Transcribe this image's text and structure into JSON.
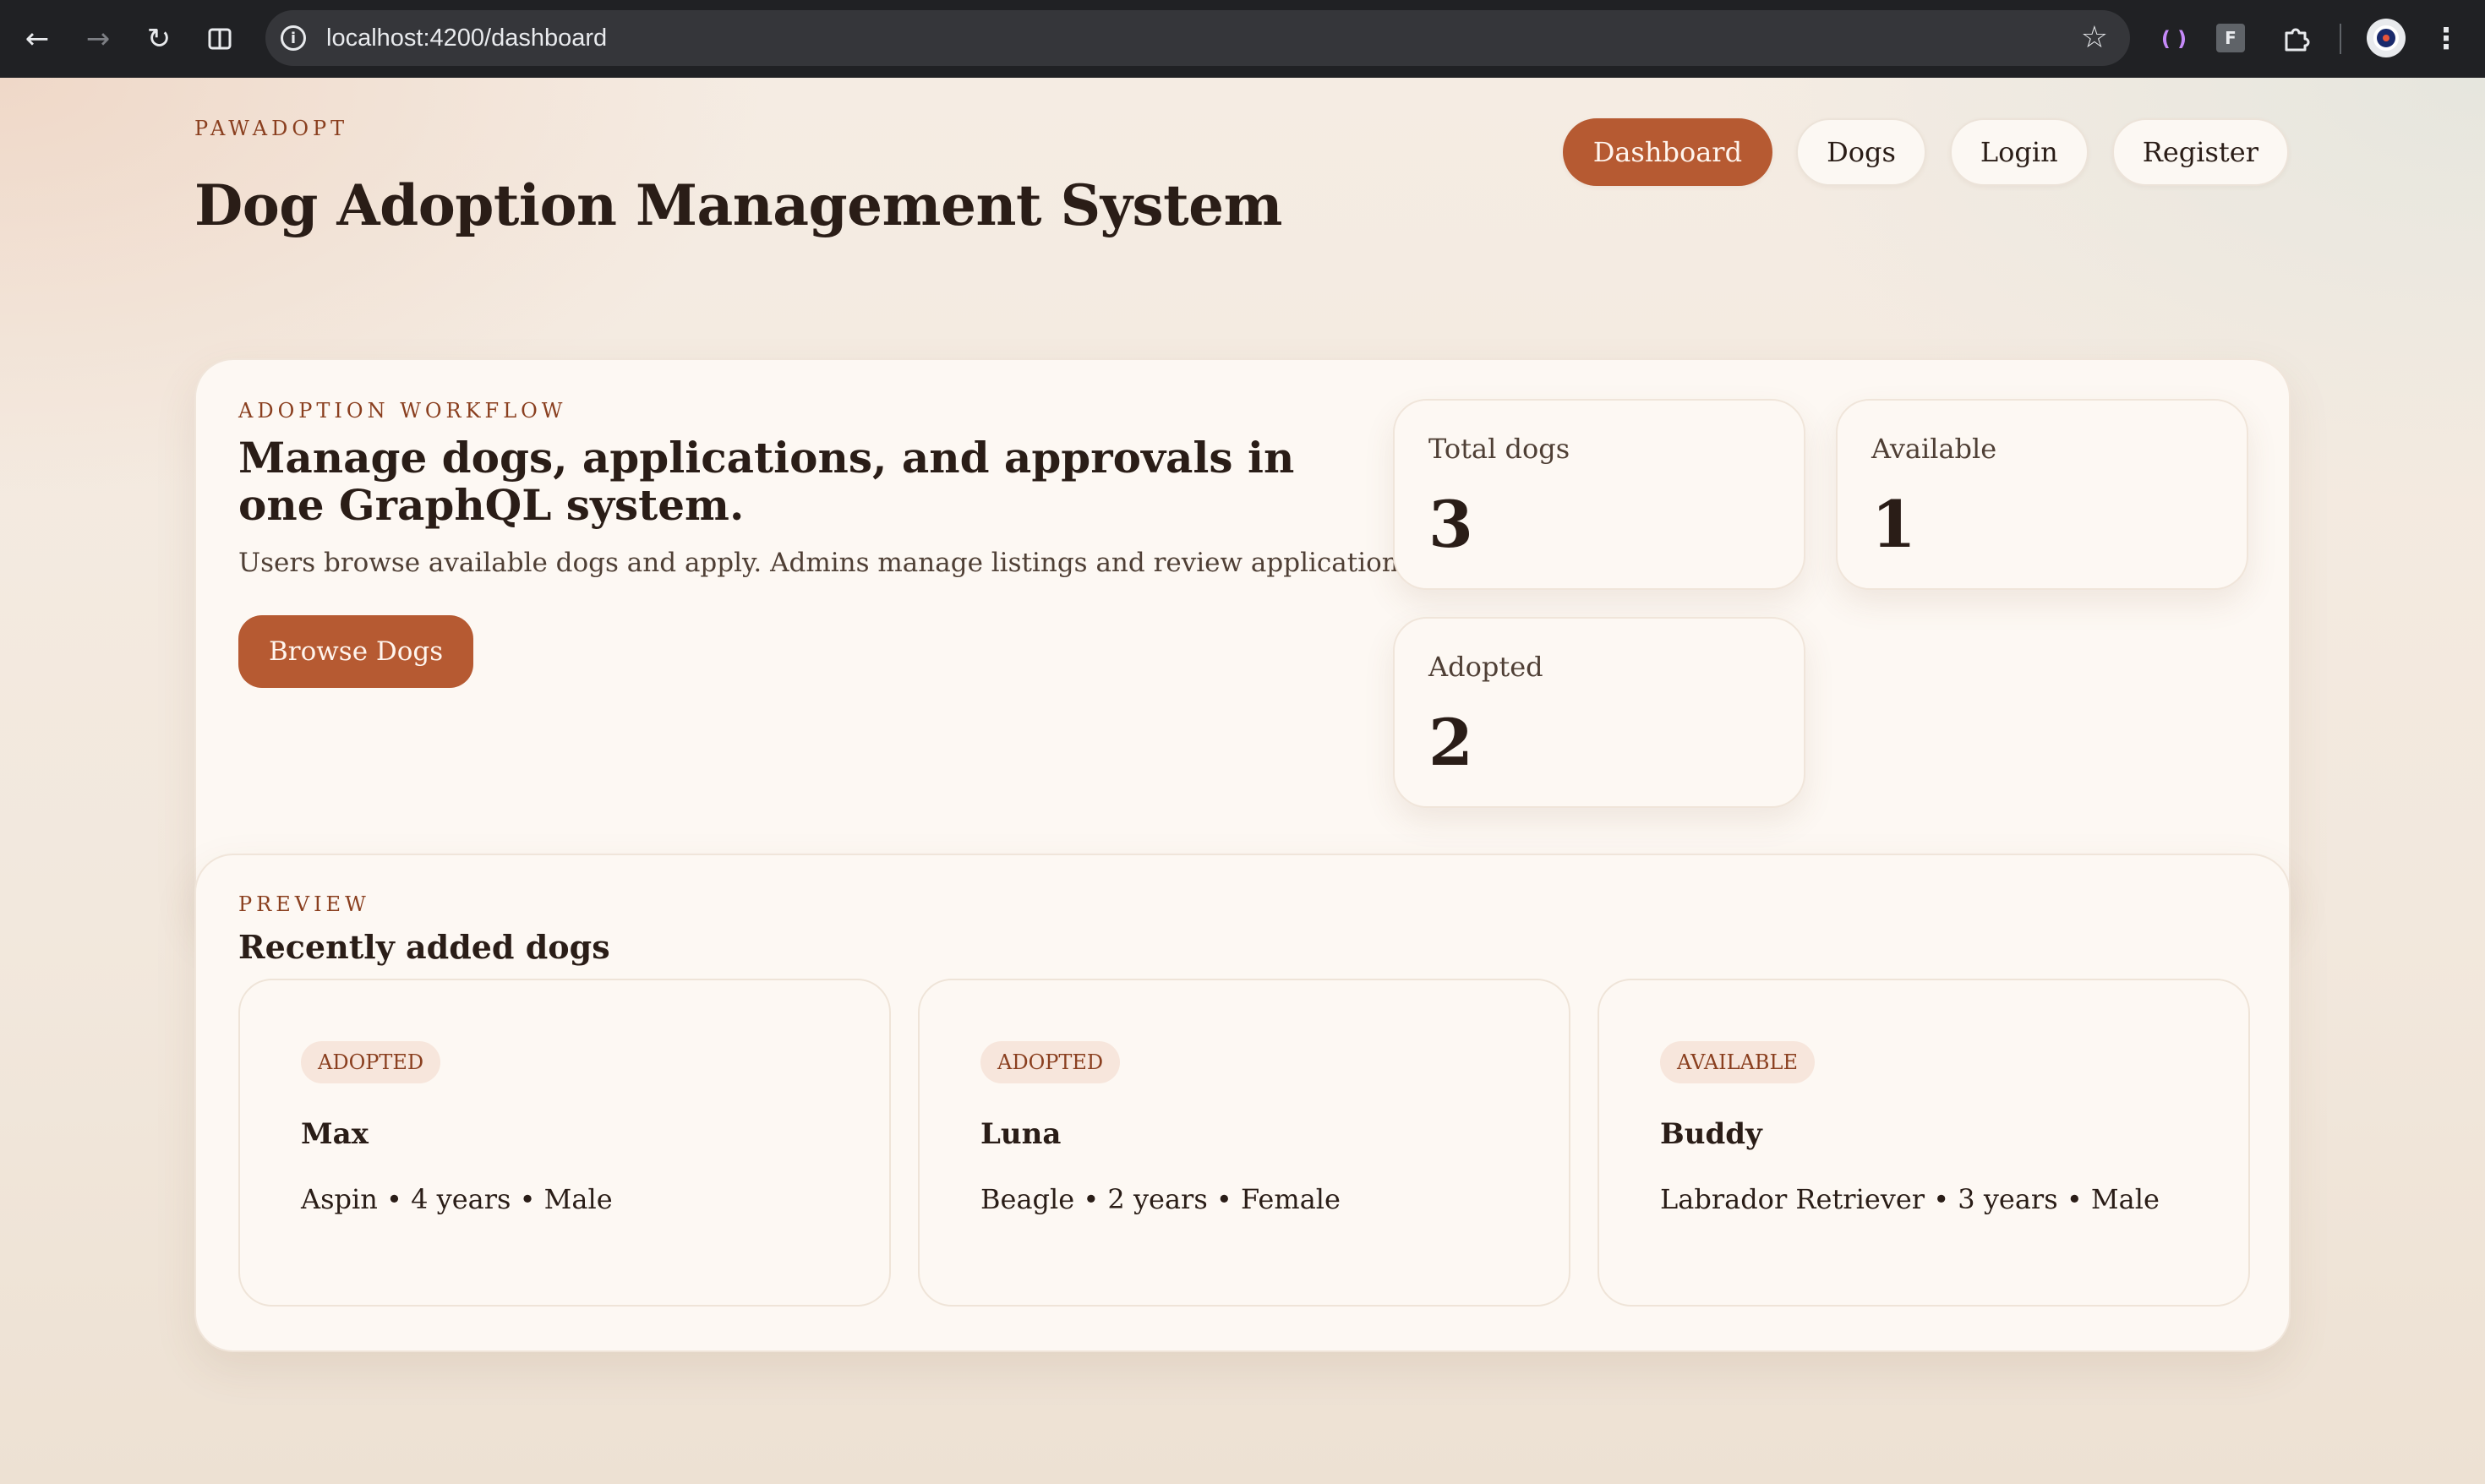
{
  "browser": {
    "url": "localhost:4200/dashboard",
    "icons": [
      "back-arrow-icon",
      "forward-arrow-icon",
      "reload-icon",
      "split-view-icon",
      "site-info-icon",
      "bookmark-star-icon",
      "extension-icon",
      "puzzle-icon",
      "profile-icon",
      "menu-icon"
    ],
    "ext_f_label": "F"
  },
  "header": {
    "brand": "PAWADOPT",
    "title": "Dog Adoption Management System",
    "nav": [
      {
        "label": "Dashboard",
        "active": true
      },
      {
        "label": "Dogs",
        "active": false
      },
      {
        "label": "Login",
        "active": false
      },
      {
        "label": "Register",
        "active": false
      }
    ]
  },
  "hero": {
    "eyebrow": "ADOPTION WORKFLOW",
    "heading": "Manage dogs, applications, and approvals in one GraphQL system.",
    "description": "Users browse available dogs and apply. Admins manage listings and review applications.",
    "cta_label": "Browse Dogs",
    "stats": {
      "total": {
        "label": "Total dogs",
        "value": "3"
      },
      "available": {
        "label": "Available",
        "value": "1"
      },
      "adopted": {
        "label": "Adopted",
        "value": "2"
      }
    }
  },
  "preview": {
    "eyebrow": "PREVIEW",
    "heading": "Recently added dogs",
    "dogs": [
      {
        "status": "ADOPTED",
        "name": "Max",
        "meta": "Aspin • 4 years • Male"
      },
      {
        "status": "ADOPTED",
        "name": "Luna",
        "meta": "Beagle • 2 years • Female"
      },
      {
        "status": "AVAILABLE",
        "name": "Buddy",
        "meta": "Labrador Retriever • 3 years • Male"
      }
    ]
  },
  "colors": {
    "accent": "#b65a32",
    "eyebrow": "#8a3f1f",
    "text": "#2a1d17",
    "card_bg": "#fdf8f3",
    "badge_bg": "#f7e6dc",
    "chrome_bg": "#202124"
  }
}
